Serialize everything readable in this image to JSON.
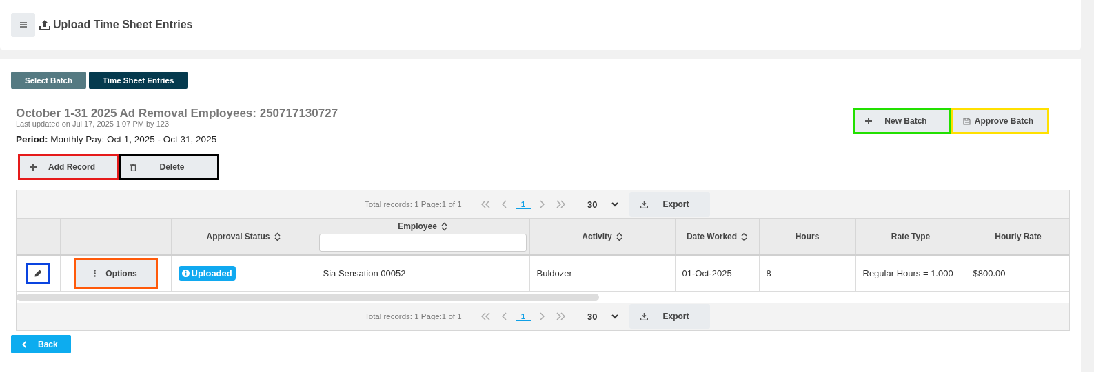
{
  "header": {
    "title": "Upload Time Sheet Entries"
  },
  "tabs": [
    {
      "label": "Select Batch",
      "selected": false
    },
    {
      "label": "Time Sheet Entries",
      "selected": true
    }
  ],
  "batch": {
    "title": "October 1-31 2025 Ad Removal Employees: 250717130727",
    "updated": "Last updated on Jul 17, 2025 1:07 PM by 123",
    "period": "**Period:** Monthly Pay: Oct 1, 2025 - Oct 31, 2025"
  },
  "batch_actions": [
    {
      "kind": "add",
      "label": "New Batch",
      "color": "#22e000"
    },
    {
      "kind": "save",
      "label": "Approve Batch",
      "color": "#ffe000"
    }
  ],
  "record_actions": [
    {
      "kind": "add",
      "label": "Add Record",
      "color": "#e51a1a"
    },
    {
      "kind": "delete",
      "label": "Delete",
      "color": "#000000"
    }
  ],
  "pager_top": {
    "summary": "Total records: 1 Page:1 of 1",
    "pages": [
      {
        "label": "1",
        "selected": true
      }
    ],
    "page_size": "30",
    "export_label": "Export"
  },
  "table": {
    "columns": [
      {
        "kind": "edit"
      },
      {
        "kind": "actions"
      },
      {
        "kind": "text",
        "label": "Approval Status",
        "sortable": true,
        "filter": false
      },
      {
        "kind": "text",
        "label": "Employee",
        "sortable": true,
        "filter": true
      },
      {
        "kind": "text",
        "label": "Activity",
        "sortable": true,
        "filter": false
      },
      {
        "kind": "text",
        "label": "Date Worked",
        "sortable": true,
        "filter": false
      },
      {
        "kind": "text",
        "label": "Hours",
        "sortable": false,
        "filter": false
      },
      {
        "kind": "text",
        "label": "Rate Type",
        "sortable": false,
        "filter": false
      },
      {
        "kind": "text",
        "label": "Hourly Rate",
        "sortable": false,
        "filter": false
      }
    ],
    "rows": [
      {
        "cells": [
          {
            "kind": "edit",
            "color": "#0a44e0"
          },
          {
            "kind": "options",
            "text": "Options",
            "color": "#ff5a0a"
          },
          {
            "kind": "badge",
            "text": "Uploaded"
          },
          {
            "kind": "text",
            "text": "Sia Sensation 00052"
          },
          {
            "kind": "text",
            "text": "Buldozer"
          },
          {
            "kind": "text",
            "text": "01-Oct-2025"
          },
          {
            "kind": "text",
            "text": "8"
          },
          {
            "kind": "text",
            "text": "Regular Hours = 1.000"
          },
          {
            "kind": "text",
            "text": "$800.00"
          }
        ]
      }
    ]
  },
  "pager_bottom": {
    "summary": "Total records: 1 Page:1 of 1",
    "pages": [
      {
        "label": "1",
        "selected": true
      }
    ],
    "page_size": "30",
    "export_label": "Export"
  },
  "back": {
    "label": "Back"
  }
}
